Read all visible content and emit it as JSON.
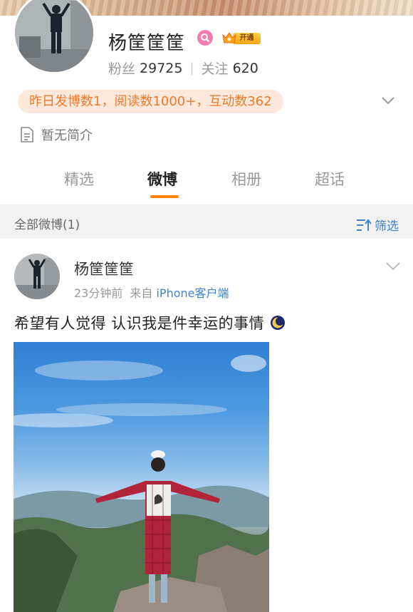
{
  "profile": {
    "username": "杨筐筐筐",
    "vip_label": "开通",
    "fans_label": "粉丝",
    "fans_count": "29725",
    "following_label": "关注",
    "following_count": "620",
    "summary": "昨日发博数1，阅读数1000+，互动数362",
    "bio": "暂无简介"
  },
  "tabs": [
    {
      "label": "精选"
    },
    {
      "label": "微博"
    },
    {
      "label": "相册"
    },
    {
      "label": "超话"
    }
  ],
  "active_tab": "微博",
  "filter_bar": {
    "count_label": "全部微博(1)",
    "filter_label": "筛选"
  },
  "post": {
    "author": "杨筐筐筐",
    "time": "23分钟前",
    "source_prefix": "来自",
    "source": "iPhone客户端",
    "text": "希望有人觉得 认识我是件幸运的事情"
  },
  "colors": {
    "accent": "#ff8200",
    "link": "#3d83cf",
    "summary_bg": "#fde9dc",
    "summary_text": "#f07a2c",
    "search_badge": "#f47cae"
  },
  "icons": [
    "search-icon",
    "vip-crown-icon",
    "chevron-down-icon",
    "document-icon",
    "filter-icon",
    "moon-emoji-icon"
  ]
}
